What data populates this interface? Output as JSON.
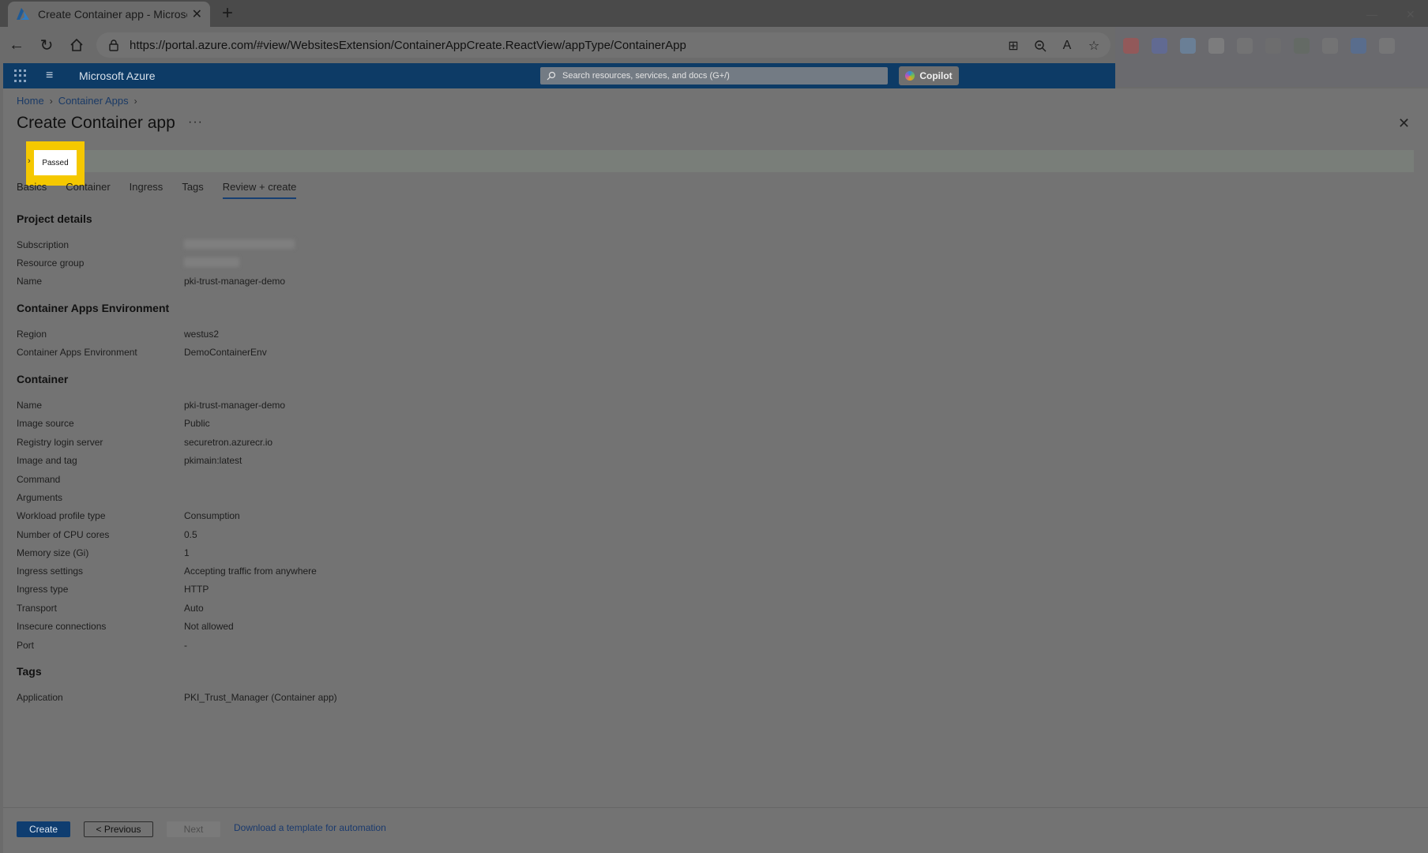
{
  "browser": {
    "tab_title": "Create Container app - Microsoft",
    "new_tab_label": "+",
    "url": "https://portal.azure.com/#view/WebsitesExtension/ContainerAppCreate.ReactView/appType/ContainerApp"
  },
  "azure": {
    "brand": "Microsoft Azure",
    "search_placeholder": "Search resources, services, and docs (G+/)",
    "copilot_label": "Copilot"
  },
  "breadcrumb": [
    {
      "label": "Home"
    },
    {
      "label": "Container Apps"
    }
  ],
  "page": {
    "title": "Create Container app",
    "more_label": "···",
    "validation_status": "Passed"
  },
  "tabs": [
    {
      "label": "Basics",
      "active": false
    },
    {
      "label": "Container",
      "active": false
    },
    {
      "label": "Ingress",
      "active": false
    },
    {
      "label": "Tags",
      "active": false
    },
    {
      "label": "Review + create",
      "active": true
    }
  ],
  "sections": {
    "project": {
      "heading": "Project details",
      "rows": [
        {
          "label": "Subscription",
          "value": ""
        },
        {
          "label": "Resource group",
          "value": ""
        },
        {
          "label": "Name",
          "value": "pki-trust-manager-demo"
        }
      ]
    },
    "environment": {
      "heading": "Container Apps Environment",
      "rows": [
        {
          "label": "Region",
          "value": "westus2"
        },
        {
          "label": "Container Apps Environment",
          "value": "DemoContainerEnv"
        }
      ]
    },
    "container": {
      "heading": "Container",
      "rows": [
        {
          "label": "Name",
          "value": "pki-trust-manager-demo"
        },
        {
          "label": "Image source",
          "value": "Public"
        },
        {
          "label": "Registry login server",
          "value": "securetron.azurecr.io"
        },
        {
          "label": "Image and tag",
          "value": "pkimain:latest"
        },
        {
          "label": "Command",
          "value": ""
        },
        {
          "label": "Arguments",
          "value": ""
        },
        {
          "label": "Workload profile type",
          "value": "Consumption"
        },
        {
          "label": "Number of CPU cores",
          "value": "0.5"
        },
        {
          "label": "Memory size (Gi)",
          "value": "1"
        },
        {
          "label": "Ingress settings",
          "value": "Accepting traffic from anywhere"
        },
        {
          "label": "Ingress type",
          "value": "HTTP"
        },
        {
          "label": "Transport",
          "value": "Auto"
        },
        {
          "label": "Insecure connections",
          "value": "Not allowed"
        },
        {
          "label": "Port",
          "value": "-"
        }
      ]
    },
    "tags": {
      "heading": "Tags",
      "rows": [
        {
          "label": "Application",
          "value": "PKI_Trust_Manager (Container app)"
        }
      ]
    }
  },
  "footer": {
    "create_label": "Create",
    "previous_label": "< Previous",
    "next_label": "Next",
    "download_link": "Download a template for automation"
  },
  "colors": {
    "azure_header": "#0d3b66",
    "highlight": "#f5c800",
    "primary_button": "#0f3d70"
  }
}
